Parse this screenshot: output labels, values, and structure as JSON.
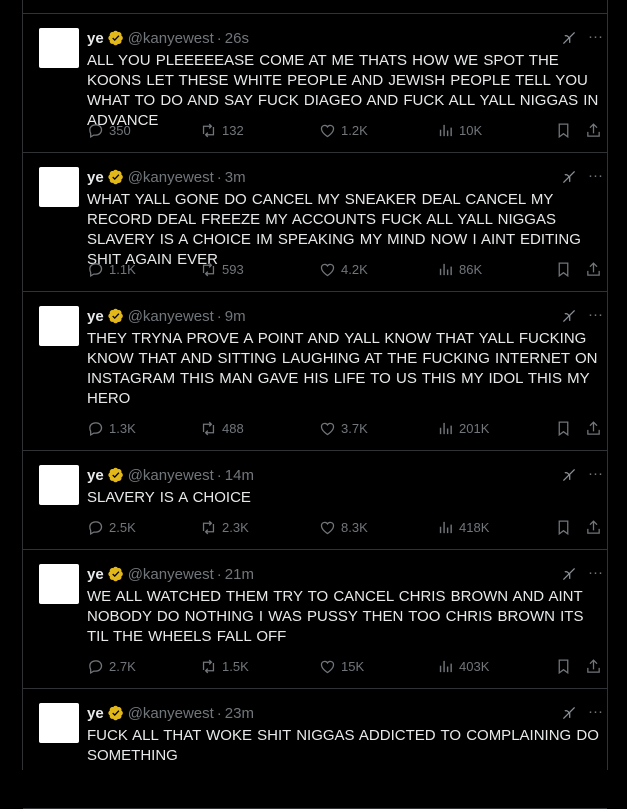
{
  "colors": {
    "background": "#000000",
    "text": "#e7e9ea",
    "muted": "#71767b",
    "divider": "#2f3336",
    "verified": "#e2b719"
  },
  "icons": {
    "verified": "verified-badge-icon",
    "grok": "grok-icon",
    "more": "more-icon",
    "reply": "reply-icon",
    "retweet": "retweet-icon",
    "like": "heart-icon",
    "views": "views-icon",
    "bookmark": "bookmark-icon",
    "share": "share-icon"
  },
  "tweets": [
    {
      "name": "ye",
      "handle": "@kanyewest",
      "sep": "·",
      "time": "26s",
      "text": "ALL YOU PLEEEEEASE COME AT ME    THATS HOW WE SPOT THE KOONS LET THESE WHITE PEOPLE AND JEWISH PEOPLE TELL YOU WHAT TO DO AND SAY FUCK DIAGEO    AND FUCK ALL YALL NIGGAS IN ADVANCE",
      "replies": "350",
      "retweets": "132",
      "likes": "1.2K",
      "views": "10K"
    },
    {
      "name": "ye",
      "handle": "@kanyewest",
      "sep": "·",
      "time": "3m",
      "text": "WHAT YALL GONE DO    CANCEL MY SNEAKER DEAL  CANCEL MY RECORD DEAL  FREEZE MY ACCOUNTS  FUCK ALL YALL NIGGAS  SLAVERY IS A CHOICE    IM SPEAKING MY MIND NOW    I AINT EDITING SHIT AGAIN EVER",
      "replies": "1.1K",
      "retweets": "593",
      "likes": "4.2K",
      "views": "86K"
    },
    {
      "name": "ye",
      "handle": "@kanyewest",
      "sep": "·",
      "time": "9m",
      "text": "THEY TRYNA PROVE A POINT AND YALL KNOW THAT    YALL FUCKING KNOW THAT    AND SITTING LAUGHING AT THE FUCKING INTERNET ON INSTAGRAM  THIS MAN GAVE HIS LIFE  TO US    THIS MY IDOL   THIS MY HERO",
      "replies": "1.3K",
      "retweets": "488",
      "likes": "3.7K",
      "views": "201K"
    },
    {
      "name": "ye",
      "handle": "@kanyewest",
      "sep": "·",
      "time": "14m",
      "text": "SLAVERY IS A CHOICE",
      "replies": "2.5K",
      "retweets": "2.3K",
      "likes": "8.3K",
      "views": "418K"
    },
    {
      "name": "ye",
      "handle": "@kanyewest",
      "sep": "·",
      "time": "21m",
      "text": "WE ALL WATCHED THEM TRY TO CANCEL CHRIS BROWN AND AINT NOBODY DO NOTHING  I WAS PUSSY THEN TOO  CHRIS BROWN ITS TIL THE WHEELS FALL OFF",
      "replies": "2.7K",
      "retweets": "1.5K",
      "likes": "15K",
      "views": "403K"
    },
    {
      "name": "ye",
      "handle": "@kanyewest",
      "sep": "·",
      "time": "23m",
      "text": "FUCK ALL THAT WOKE SHIT    NIGGAS ADDICTED TO COMPLAINING     DO SOMETHING",
      "replies": "",
      "retweets": "",
      "likes": "",
      "views": ""
    }
  ]
}
